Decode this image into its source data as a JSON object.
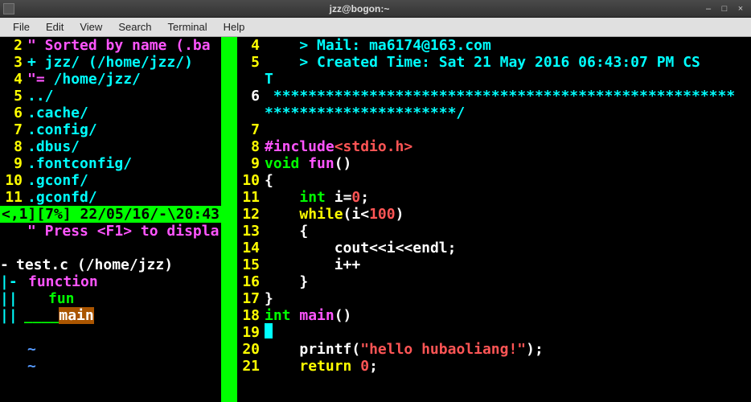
{
  "window": {
    "title": "jzz@bogon:~",
    "minimize": "–",
    "maximize": "□",
    "close": "×"
  },
  "menu": {
    "file": "File",
    "edit": "Edit",
    "view": "View",
    "search": "Search",
    "terminal": "Terminal",
    "help": "Help"
  },
  "left": {
    "l2": {
      "num": "2",
      "quote": "\"",
      "text": " Sorted by name (.ba"
    },
    "l3": {
      "num": "3",
      "plus": "+",
      "path": " jzz/ (/home/jzz/)"
    },
    "l4": {
      "num": "4",
      "eq": "\"=",
      "path": " /home/jzz/"
    },
    "l5": {
      "num": "5",
      "text": "../"
    },
    "l6": {
      "num": "6",
      "text": ".cache/"
    },
    "l7": {
      "num": "7",
      "text": ".config/"
    },
    "l8": {
      "num": "8",
      "text": ".dbus/"
    },
    "l9": {
      "num": "9",
      "text": ".fontconfig/"
    },
    "l10": {
      "num": "10",
      "text": ".gconf/"
    },
    "l11": {
      "num": "11",
      "text": ".gconfd/"
    },
    "status": "<,1][7%] 22/05/16/-\\20:43",
    "help": {
      "quote": "\"",
      "text": " Press <F1> to displa"
    },
    "file": {
      "dash": "-",
      "name": "test.c (/home/jzz)"
    },
    "func_hdr": {
      "bar": "|-",
      "text": "function"
    },
    "f1": {
      "bar": "||",
      "text": "fun"
    },
    "f2": {
      "bar": "||",
      "us": "____",
      "text": "main"
    }
  },
  "right": {
    "l4": {
      "num": "4",
      "gt": "> ",
      "k": "Mail:",
      "v": " ma6174@163.com"
    },
    "l5": {
      "num": "5",
      "gt": "> ",
      "k": "Created Time:",
      "v": " Sat 21 May 2016 06:43:07 PM CS"
    },
    "l5b": "T",
    "l6": {
      "num": "6",
      "a": " *****************************************************",
      "b": "**********************/"
    },
    "l7": {
      "num": "7",
      "text": ""
    },
    "l8": {
      "num": "8",
      "inc": "#include",
      "hdr": "<stdio.h>"
    },
    "l9": {
      "num": "9",
      "kw": "void",
      "fn": " fun",
      "p": "()"
    },
    "l10": {
      "num": "10",
      "text": "{"
    },
    "l11": {
      "num": "11",
      "kw": "int",
      "var": " i",
      "eq": "=",
      "val": "0",
      "sc": ";"
    },
    "l12": {
      "num": "12",
      "kw": "while",
      "p1": "(",
      "v": "i",
      "lt": "<",
      "n": "100",
      "p2": ")"
    },
    "l13": {
      "num": "13",
      "text": "{"
    },
    "l14": {
      "num": "14",
      "c": "cout",
      "op1": "<<",
      "v": "i",
      "op2": "<<",
      "e": "endl",
      "sc": ";"
    },
    "l15": {
      "num": "15",
      "v": "i",
      "op": "++"
    },
    "l16": {
      "num": "16",
      "text": "}"
    },
    "l17": {
      "num": "17",
      "text": "}"
    },
    "l18": {
      "num": "18",
      "kw": "int",
      "fn": " main",
      "p": "()"
    },
    "l19": {
      "num": "19"
    },
    "l20": {
      "num": "20",
      "fn": "printf",
      "p1": "(",
      "s": "\"hello hubaoliang!\"",
      "p2": ")",
      "sc": ";"
    },
    "l21": {
      "num": "21",
      "kw": "return",
      "v": " 0",
      "sc": ";"
    }
  }
}
